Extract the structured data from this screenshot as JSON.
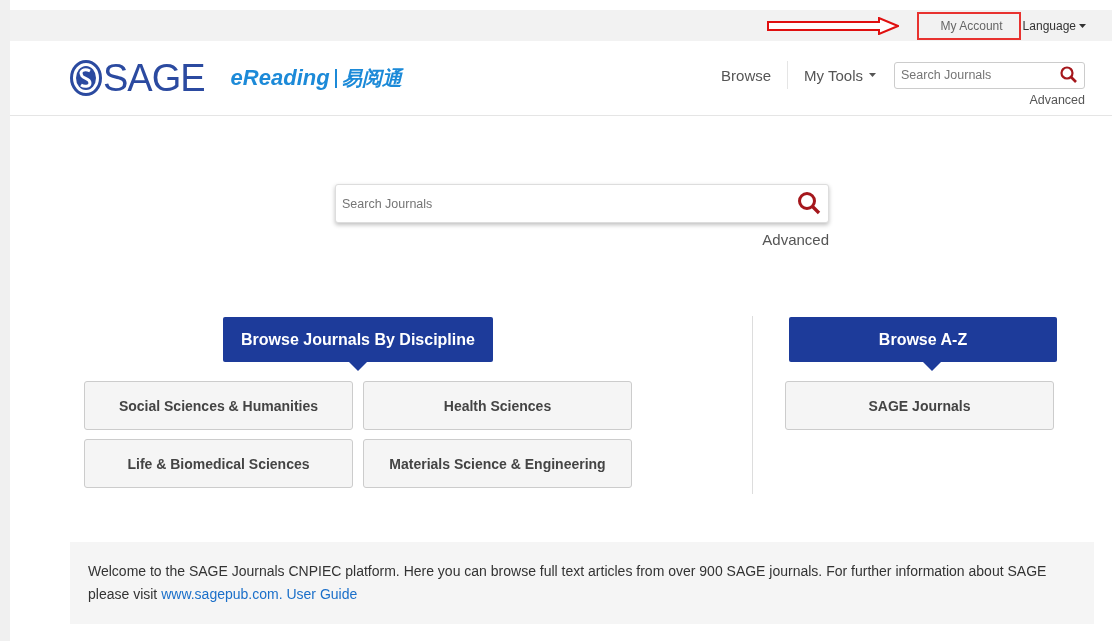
{
  "top_bar": {
    "account_link": "My Account",
    "account_highlighted": true,
    "language_menu": "Language"
  },
  "header": {
    "logo": "SAGE",
    "partner_logo": {
      "latin": "eReading",
      "chinese": "易阅通"
    },
    "nav": [
      {
        "label": "Browse",
        "dropdown": false
      },
      {
        "label": "My Tools",
        "dropdown": true
      }
    ],
    "search": {
      "placeholder": "Search Journals"
    },
    "advanced_link": "Advanced"
  },
  "main_search": {
    "placeholder": "Search Journals",
    "advanced_link": "Advanced"
  },
  "browse_discipline": {
    "heading": "Browse Journals By Discipline",
    "items": [
      "Social Sciences & Humanities",
      "Health Sciences",
      "Life & Biomedical Sciences",
      "Materials Science & Engineering"
    ]
  },
  "browse_az": {
    "heading": "Browse A-Z",
    "items": [
      "SAGE Journals"
    ]
  },
  "welcome": {
    "text": "Welcome to the SAGE Journals CNPIEC platform. Here you can browse full text articles from over 900 SAGE journals. For further information about SAGE please visit",
    "links": [
      "www.sagepub.com.",
      "User Guide"
    ]
  }
}
